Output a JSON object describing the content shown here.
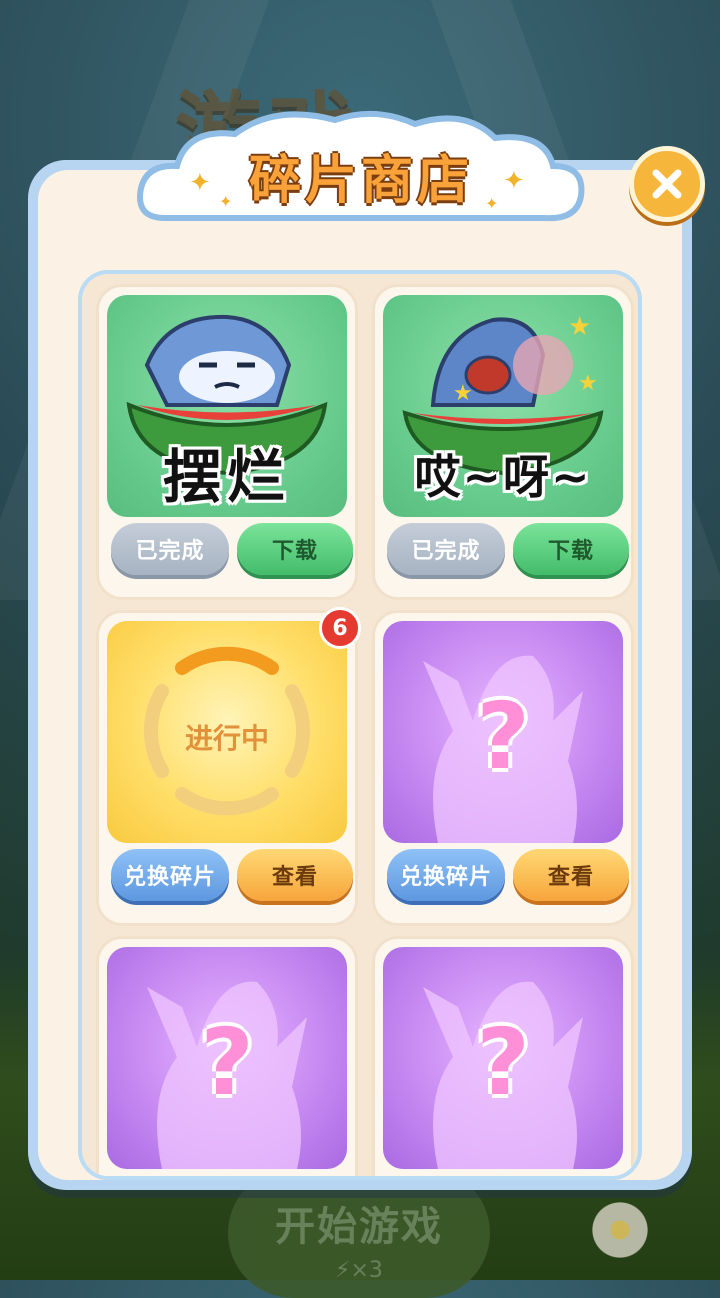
{
  "background": {
    "title_fragment": "游戏",
    "start_button_label": "开始游戏",
    "start_button_cost": "⚡×3"
  },
  "dialog": {
    "title": "碎片商店",
    "close_icon": "close-icon"
  },
  "cards": [
    {
      "state": "completed",
      "sticker_text": "摆烂",
      "left_button": "已完成",
      "right_button": "下载"
    },
    {
      "state": "completed",
      "sticker_text": "哎~呀~",
      "left_button": "已完成",
      "right_button": "下载"
    },
    {
      "state": "in-progress",
      "status_text": "进行中",
      "badge_count": "6",
      "left_button": "兑换碎片",
      "right_button": "查看"
    },
    {
      "state": "locked",
      "mystery_mark": "?",
      "left_button": "兑换碎片",
      "right_button": "查看"
    },
    {
      "state": "locked",
      "mystery_mark": "?"
    },
    {
      "state": "locked",
      "mystery_mark": "?"
    }
  ],
  "colors": {
    "panel_border": "#b7d5f1",
    "panel_fill": "#fbf1e4",
    "title_orange": "#f9a23a",
    "download_green": "#43bc6a",
    "view_orange": "#f7a53b",
    "exchange_blue": "#5d98e0",
    "completed_gray": "#a7b3c2",
    "badge_red": "#e53a2f"
  }
}
